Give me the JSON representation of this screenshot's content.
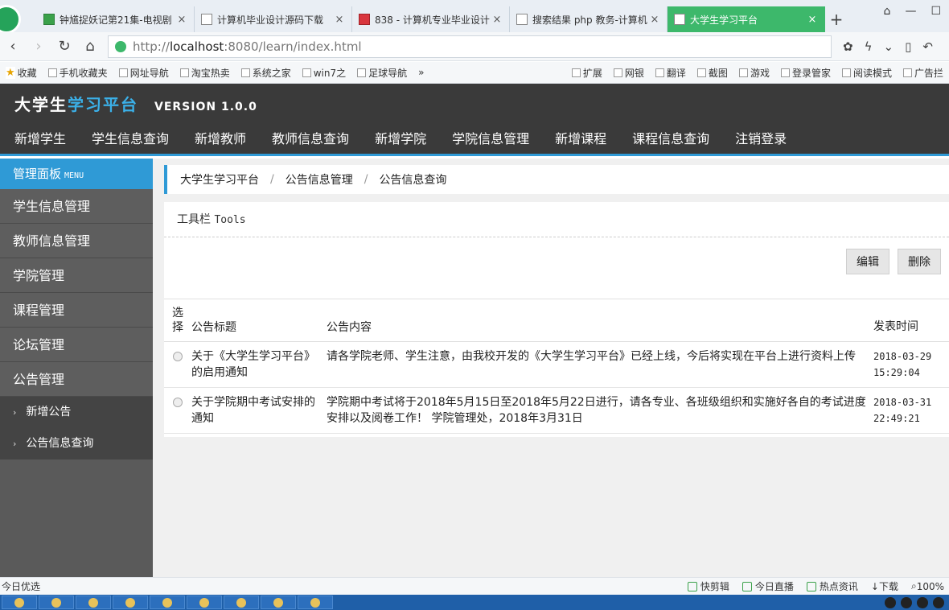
{
  "browser": {
    "tabs": [
      {
        "label": "钟馗捉妖记第21集-电视剧",
        "active": false
      },
      {
        "label": "计算机毕业设计源码下载",
        "active": false
      },
      {
        "label": "838 - 计算机专业毕业设计",
        "active": false
      },
      {
        "label": "搜索结果 php 教务-计算机",
        "active": false
      },
      {
        "label": "大学生学习平台",
        "active": true
      }
    ],
    "url_prefix": "http://",
    "url_host": "localhost",
    "url_rest": ":8080/learn/index.html",
    "bookmarks_left": [
      "收藏",
      "手机收藏夹",
      "网址导航",
      "淘宝热卖",
      "系统之家",
      "win7之",
      "足球导航",
      "»"
    ],
    "bookmarks_right": [
      "扩展",
      "网银",
      "翻译",
      "截图",
      "游戏",
      "登录管家",
      "阅读模式",
      "广告拦"
    ]
  },
  "app": {
    "brand_white": "大学生",
    "brand_blue": "学习平台",
    "version": "VERSION 1.0.0",
    "top_nav": [
      "新增学生",
      "学生信息查询",
      "新增教师",
      "教师信息查询",
      "新增学院",
      "学院信息管理",
      "新增课程",
      "课程信息查询",
      "注销登录"
    ]
  },
  "sidebar": {
    "title": "管理面板",
    "title_en": "MENU",
    "items": [
      "学生信息管理",
      "教师信息管理",
      "学院管理",
      "课程管理",
      "论坛管理",
      "公告管理"
    ],
    "subitems": [
      "新增公告",
      "公告信息查询"
    ]
  },
  "breadcrumb": [
    "大学生学习平台",
    "公告信息管理",
    "公告信息查询"
  ],
  "toolbar": {
    "title": "工具栏",
    "title_en": "Tools",
    "edit_label": "编辑",
    "delete_label": "删除"
  },
  "table": {
    "headers": {
      "select": "选择",
      "title": "公告标题",
      "content": "公告内容",
      "time": "发表时间"
    },
    "rows": [
      {
        "title": "关于《大学生学习平台》的启用通知",
        "content": "请各学院老师、学生注意，由我校开发的《大学生学习平台》已经上线，今后将实现在平台上进行资料上传",
        "time": "2018-03-29 15:29:04"
      },
      {
        "title": "关于学院期中考试安排的通知",
        "content": "学院期中考试将于2018年5月15日至2018年5月22日进行，请各专业、各班级组织和实施好各自的考试进度安排以及阅卷工作！ 学院管理处，2018年3月31日",
        "time": "2018-03-31 22:49:21"
      }
    ]
  },
  "statusbar": {
    "left": "今日优选",
    "right": [
      "快剪辑",
      "今日直播",
      "热点资讯",
      "下载",
      "100%"
    ]
  },
  "colors": {
    "accent": "#2f9ad6",
    "header_bg": "#3a3a3a",
    "sidebar_bg": "#5a5a5a",
    "tab_active": "#3db86b"
  }
}
